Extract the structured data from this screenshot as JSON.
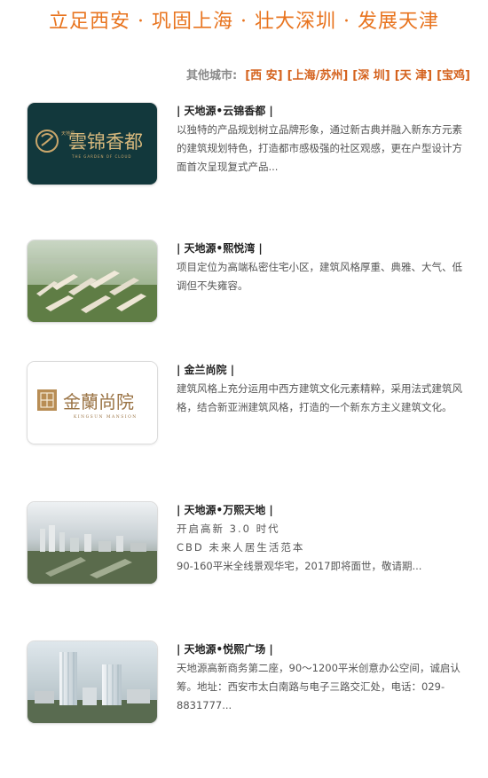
{
  "headline": "立足西安 · 巩固上海 · 壮大深圳 · 发展天津",
  "cities": {
    "label": "其他城市:",
    "links": [
      "[西 安]",
      "[上海/苏州]",
      "[深 圳]",
      "[天 津]",
      "[宝鸡]"
    ]
  },
  "logos": {
    "yunjin_cn": "雲锦香都",
    "yunjin_brand": "天地源",
    "yunjin_en": "THE GARDEN OF CLOUD",
    "jinlan_cn": "金蘭尚院",
    "jinlan_en": "KINGSUN MANSION"
  },
  "projects": [
    {
      "title": "| 天地源•云锦香都 |",
      "desc": "以独特的产品规划树立品牌形象，通过新古典并融入新东方元素的建筑规划特色，打造都市感极强的社区观感，更在户型设计方面首次呈现复式产品..."
    },
    {
      "title": "| 天地源•熙悦湾 |",
      "desc": "项目定位为高端私密住宅小区，建筑风格厚重、典雅、大气、低调但不失雍容。"
    },
    {
      "title": "| 金兰尚院 |",
      "desc": "建筑风格上充分运用中西方建筑文化元素精粹，采用法式建筑风格，结合新亚洲建筑风格，打造的一个新东方主义建筑文化。"
    },
    {
      "title": "| 天地源•万熙天地 |",
      "line1": "开启高新 3.0 时代",
      "line2": "CBD 未来人居生活范本",
      "line3": "90-160平米全线景观华宅，2017即将面世，敬请期..."
    },
    {
      "title": "| 天地源•悦熙广场 |",
      "desc": "天地源高新商务第二座，90～1200平米创意办公空间，诚启认筹。地址：西安市太白南路与电子三路交汇处，电话：029-8831777..."
    }
  ],
  "colors": {
    "accent": "#e8741f",
    "link": "#d4611c",
    "logo_gold": "#c9a66b",
    "logo_bg": "#12383c"
  }
}
